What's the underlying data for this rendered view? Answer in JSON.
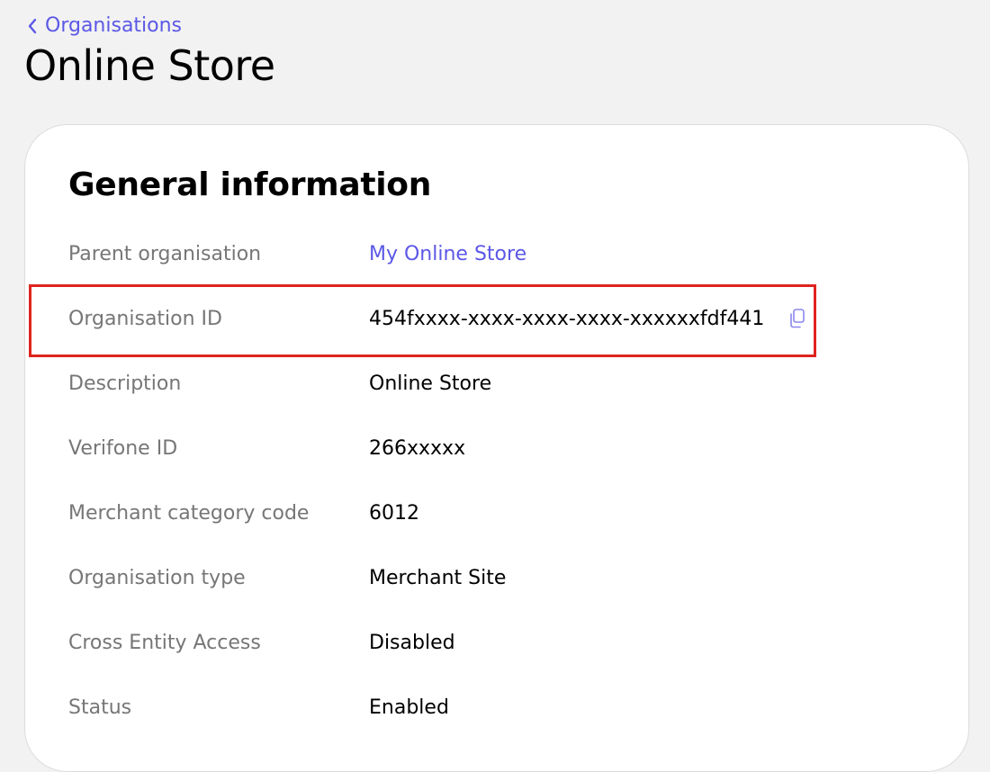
{
  "breadcrumb": {
    "label": "Organisations"
  },
  "page": {
    "title": "Online Store"
  },
  "card": {
    "title": "General information",
    "rows": [
      {
        "label": "Parent organisation",
        "value": "My Online Store"
      },
      {
        "label": "Organisation ID",
        "value": "454fxxxx-xxxx-xxxx-xxxx-xxxxxxfdf441"
      },
      {
        "label": "Description",
        "value": "Online Store"
      },
      {
        "label": "Verifone ID",
        "value": "266xxxxx"
      },
      {
        "label": "Merchant category code",
        "value": "6012"
      },
      {
        "label": "Organisation type",
        "value": "Merchant Site"
      },
      {
        "label": "Cross Entity Access",
        "value": "Disabled"
      },
      {
        "label": "Status",
        "value": "Enabled"
      }
    ]
  },
  "icons": {
    "breadcrumb_back": "chevron-left-icon",
    "copy": "copy-icon"
  },
  "colors": {
    "accent": "#5b58e6",
    "highlight": "#e0241f",
    "label": "#767676",
    "background": "#f2f2f2"
  }
}
